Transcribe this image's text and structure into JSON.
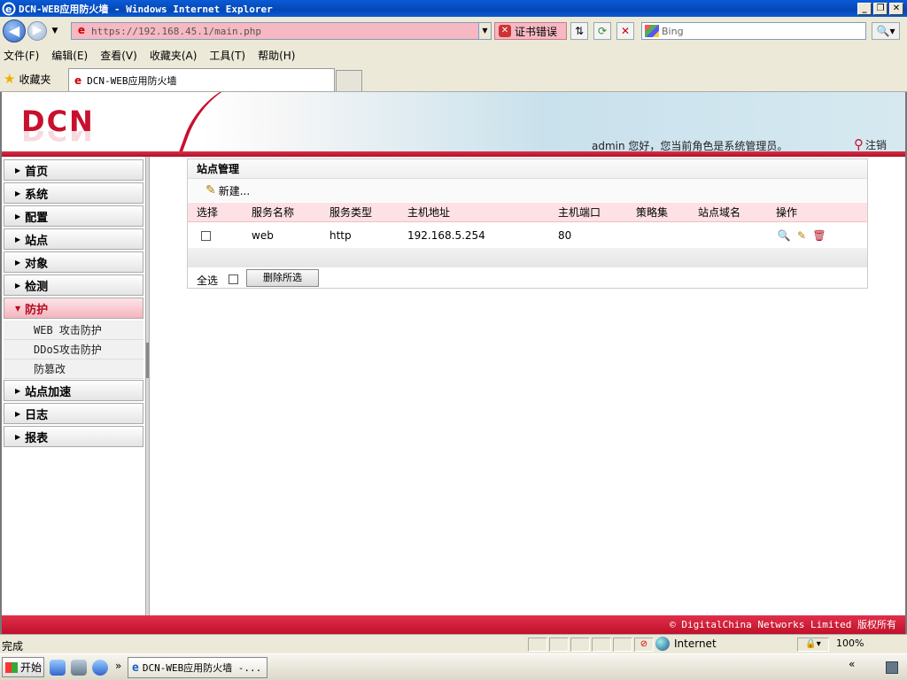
{
  "window": {
    "title": "DCN-WEB应用防火墙 - Windows Internet Explorer",
    "min": "_",
    "max": "❐",
    "close": "✕"
  },
  "address": {
    "url": "https://192.168.45.1/main.php",
    "cert_error": "证书错误",
    "search_placeholder": "Bing"
  },
  "menubar": [
    "文件(F)",
    "编辑(E)",
    "查看(V)",
    "收藏夹(A)",
    "工具(T)",
    "帮助(H)"
  ],
  "favorites": {
    "label": "收藏夹",
    "tab_title": "DCN-WEB应用防火墙"
  },
  "banner": {
    "logo": "DCN",
    "user_greeting": "admin 您好，您当前角色是系统管理员。",
    "logout": "注销"
  },
  "sidebar": {
    "items": [
      {
        "label": "首页"
      },
      {
        "label": "系统"
      },
      {
        "label": "配置"
      },
      {
        "label": "站点"
      },
      {
        "label": "对象"
      },
      {
        "label": "检测"
      },
      {
        "label": "防护"
      },
      {
        "label": "站点加速"
      },
      {
        "label": "日志"
      },
      {
        "label": "报表"
      }
    ],
    "subitems": [
      {
        "label": "WEB 攻击防护"
      },
      {
        "label": "DDoS攻击防护"
      },
      {
        "label": "防篡改"
      }
    ]
  },
  "panel": {
    "title": "站点管理",
    "new_label": "新建...",
    "columns": [
      "选择",
      "服务名称",
      "服务类型",
      "主机地址",
      "主机端口",
      "策略集",
      "站点域名",
      "操作"
    ],
    "rows": [
      {
        "name": "web",
        "type": "http",
        "host": "192.168.5.254",
        "port": "80",
        "policy": "",
        "domain": ""
      }
    ],
    "select_all": "全选",
    "delete_selected": "删除所选"
  },
  "footer": {
    "copyright": "© DigitalChina Networks Limited 版权所有"
  },
  "statusbar": {
    "text": "完成",
    "zone": "Internet",
    "zoom": "100%"
  },
  "taskbar": {
    "start": "开始",
    "chevron": "»",
    "task_item": "DCN-WEB应用防火墙 -...",
    "tray": "«"
  },
  "colors": {
    "accent": "#c8102e",
    "header_pink": "#fde1e4"
  }
}
